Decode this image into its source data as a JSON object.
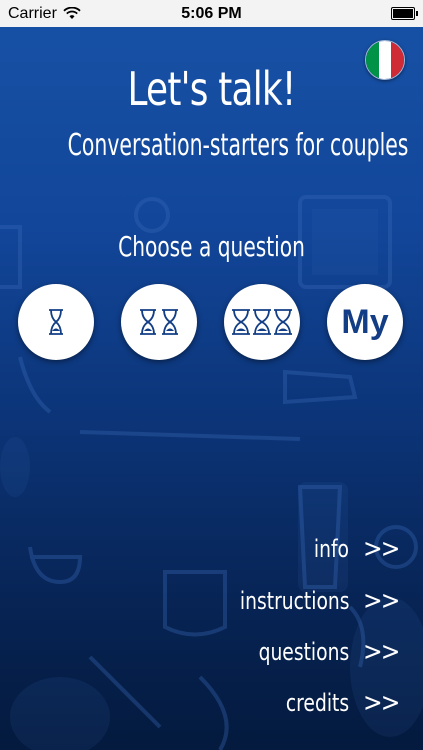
{
  "status_bar": {
    "carrier": "Carrier",
    "time": "5:06 PM"
  },
  "header": {
    "title": "Let's talk!",
    "subtitle": "Conversation-starters for couples"
  },
  "language_flag": {
    "icon": "italian-flag-icon",
    "colors": [
      "#009246",
      "#ffffff",
      "#ce2b37"
    ]
  },
  "question_section": {
    "prompt": "Choose a question",
    "options": [
      {
        "icon": "hourglass-icon",
        "count": 1
      },
      {
        "icon": "hourglass-icon",
        "count": 2
      },
      {
        "icon": "hourglass-icon",
        "count": 3
      },
      {
        "label": "My"
      }
    ]
  },
  "menu": {
    "arrow": ">>",
    "items": [
      {
        "label": "info"
      },
      {
        "label": "instructions"
      },
      {
        "label": "questions"
      },
      {
        "label": "credits"
      }
    ]
  },
  "colors": {
    "accent": "#133e86",
    "background_top": "#1752a6",
    "background_bottom": "#041a3e"
  }
}
